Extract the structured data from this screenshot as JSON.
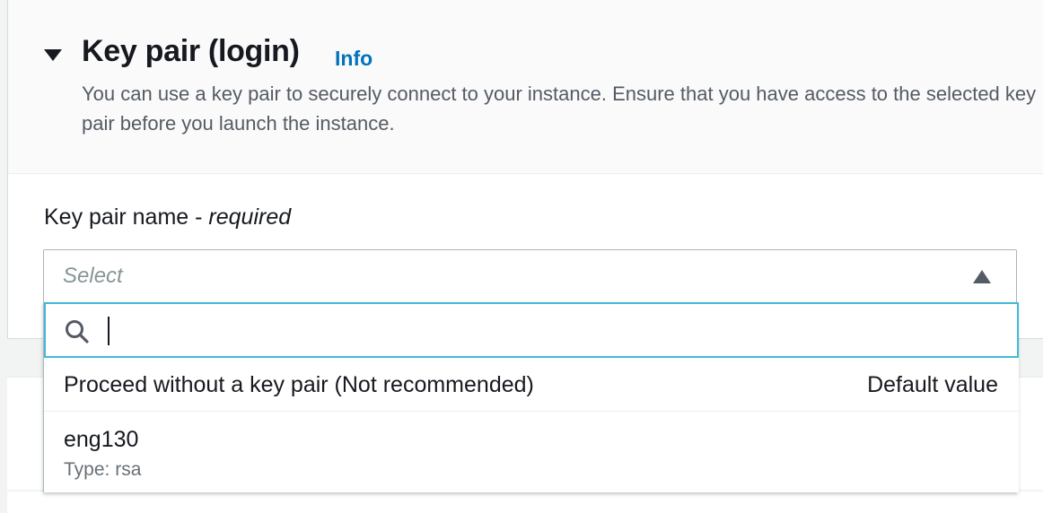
{
  "section": {
    "title": "Key pair (login)",
    "info_link": "Info",
    "description": "You can use a key pair to securely connect to your instance. Ensure that you have access to the selected key pair before you launch the instance."
  },
  "field": {
    "label": "Key pair name - ",
    "label_required": "required"
  },
  "select": {
    "placeholder": "Select",
    "search_value": "",
    "options": [
      {
        "label": "Proceed without a key pair (Not recommended)",
        "tag": "Default value"
      },
      {
        "label": "eng130",
        "description": "Type: rsa"
      }
    ]
  },
  "icons": {
    "section_toggle": "caret-down-icon",
    "select_toggle": "caret-up-icon",
    "search": "search-icon"
  },
  "colors": {
    "link": "#0073bb",
    "focus_border": "#44b9d6",
    "text": "#16191f",
    "secondary_text": "#545b64"
  }
}
